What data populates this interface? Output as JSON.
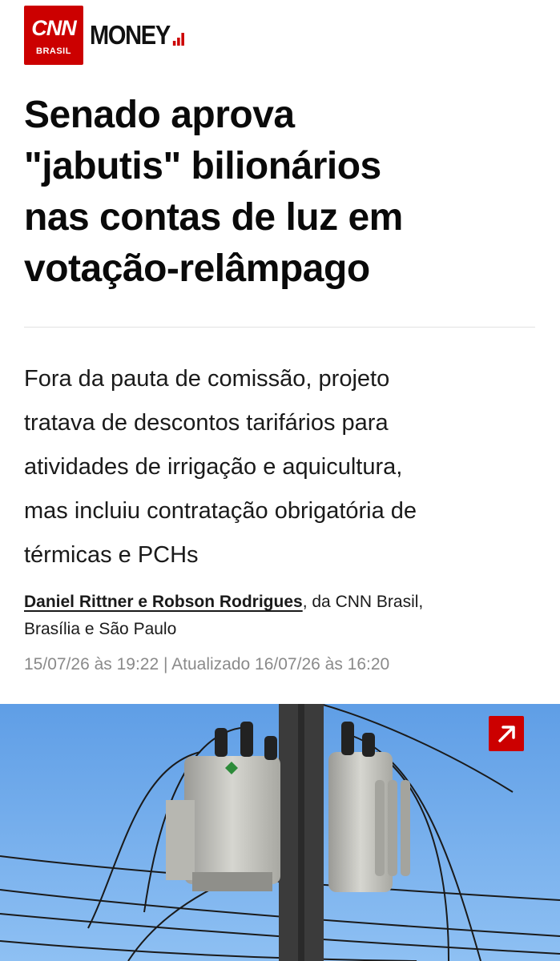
{
  "brand": {
    "logo_text": "CNN",
    "logo_subtext": "BRASIL",
    "section_name": "MONEY",
    "brand_color": "#cc0000"
  },
  "article": {
    "headline_lines": [
      "Senado aprova",
      "\"jabutis\" bilionários",
      "nas contas de luz em",
      "votação-relâmpago"
    ],
    "summary_lines": [
      "Fora da pauta de comissão, projeto",
      "tratava de descontos tarifários para",
      "atividades de irrigação e aquicultura,",
      "mas incluiu contratação obrigatória de",
      "térmicas e PCHs"
    ],
    "authors": "Daniel Rittner e Robson Rodrigues",
    "author_suffix": ", da CNN Brasil,",
    "location": "Brasília e São Paulo",
    "published": "15/07/26 às 19:22",
    "separator": "|",
    "updated": "Atualizado 16/07/26 às 16:20"
  },
  "photo": {
    "icon": "expand-arrow-icon"
  }
}
